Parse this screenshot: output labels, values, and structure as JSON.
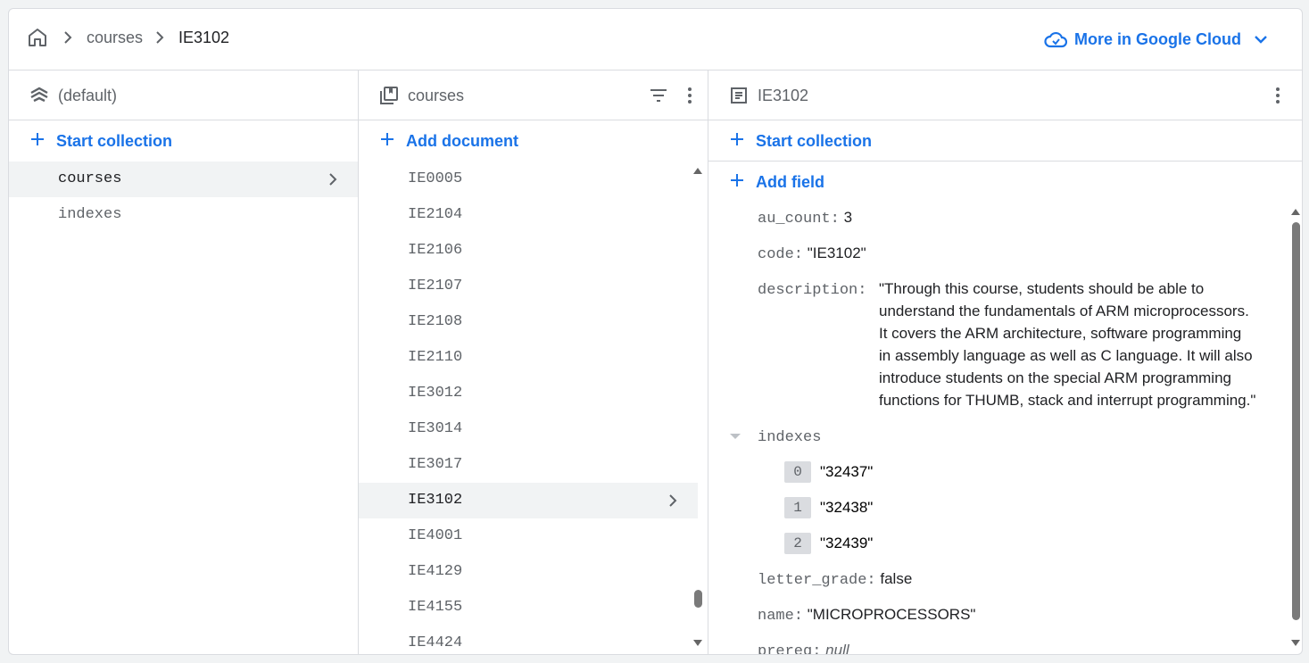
{
  "breadcrumb": {
    "items": [
      "courses",
      "IE3102"
    ]
  },
  "header": {
    "cloud_label": "More in Google Cloud"
  },
  "col1": {
    "title": "(default)",
    "add_label": "Start collection",
    "items": [
      "courses",
      "indexes"
    ]
  },
  "col2": {
    "title": "courses",
    "add_label": "Add document",
    "items": [
      "IE0005",
      "IE2104",
      "IE2106",
      "IE2107",
      "IE2108",
      "IE2110",
      "IE3012",
      "IE3014",
      "IE3017",
      "IE3102",
      "IE4001",
      "IE4129",
      "IE4155",
      "IE4424"
    ]
  },
  "col3": {
    "title": "IE3102",
    "add_collection_label": "Start collection",
    "add_field_label": "Add field",
    "fields": {
      "au_count_key": "au_count:",
      "au_count_val": "3",
      "code_key": "code:",
      "code_val": "\"IE3102\"",
      "description_key": "description:",
      "description_lines": [
        "\"Through this course, students should be able to",
        "understand the fundamentals of ARM microprocessors.",
        "It covers the ARM architecture, software programming",
        "in assembly language as well as C language. It will also",
        "introduce students on the special ARM programming",
        "functions for THUMB, stack and interrupt programming.\""
      ],
      "indexes_key": "indexes",
      "indexes": [
        {
          "i": "0",
          "v": "\"32437\""
        },
        {
          "i": "1",
          "v": "\"32438\""
        },
        {
          "i": "2",
          "v": "\"32439\""
        }
      ],
      "letter_grade_key": "letter_grade:",
      "letter_grade_val": "false",
      "name_key": "name:",
      "name_val": "\"MICROPROCESSORS\"",
      "prereq_key": "prereq:",
      "prereq_val": "null"
    }
  },
  "colors": {
    "accent": "#1a73e8",
    "text": "#202124",
    "muted": "#5f6368",
    "border": "#dadce0",
    "selected": "#f1f3f4"
  }
}
